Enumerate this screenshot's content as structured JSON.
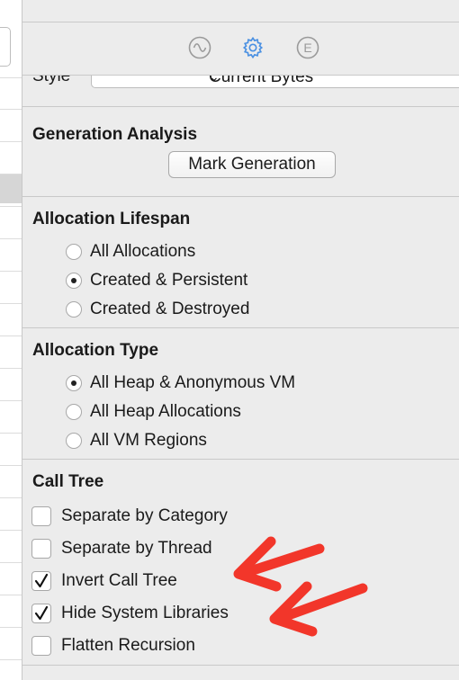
{
  "toolbar": {
    "tabs": [
      {
        "icon": "waveform-circle-icon",
        "selected": false
      },
      {
        "icon": "gear-icon",
        "selected": true
      },
      {
        "icon": "extended-detail-icon",
        "selected": false,
        "glyph": "E"
      }
    ],
    "accent": "#4a90e2"
  },
  "style": {
    "label": "Style",
    "value": "Current Bytes",
    "chevron": "⌄"
  },
  "generation_analysis": {
    "title": "Generation Analysis",
    "button": "Mark Generation"
  },
  "allocation_lifespan": {
    "title": "Allocation Lifespan",
    "options": [
      {
        "label": "All Allocations",
        "checked": false
      },
      {
        "label": "Created & Persistent",
        "checked": true
      },
      {
        "label": "Created & Destroyed",
        "checked": false
      }
    ]
  },
  "allocation_type": {
    "title": "Allocation Type",
    "options": [
      {
        "label": "All Heap & Anonymous VM",
        "checked": true
      },
      {
        "label": "All Heap Allocations",
        "checked": false
      },
      {
        "label": "All VM Regions",
        "checked": false
      }
    ]
  },
  "call_tree": {
    "title": "Call Tree",
    "options": [
      {
        "label": "Separate by Category",
        "checked": false
      },
      {
        "label": "Separate by Thread",
        "checked": false
      },
      {
        "label": "Invert Call Tree",
        "checked": true
      },
      {
        "label": "Hide System Libraries",
        "checked": true
      },
      {
        "label": "Flatten Recursion",
        "checked": false
      }
    ]
  },
  "annotation_color": "#f2362a"
}
